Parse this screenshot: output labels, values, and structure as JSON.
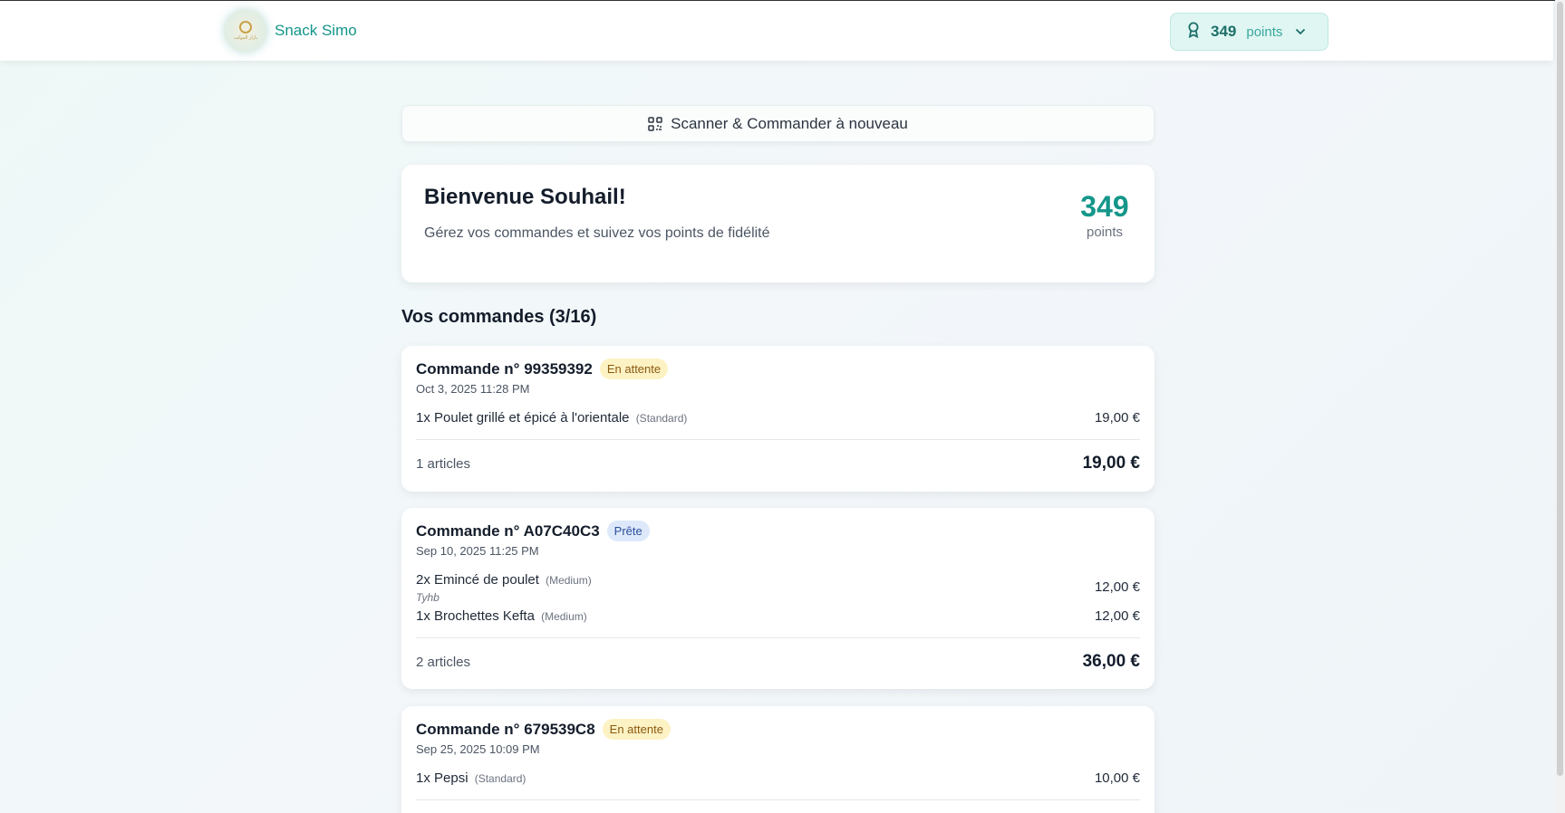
{
  "header": {
    "brand_name": "Snack Simo",
    "logo_text": "بازار الموكب",
    "points_value": "349",
    "points_label": "points"
  },
  "scan_button": {
    "label": "Scanner & Commander à nouveau"
  },
  "welcome": {
    "title": "Bienvenue Souhail!",
    "subtitle": "Gérez vos commandes et suivez vos points de fidélité",
    "points_value": "349",
    "points_label": "points"
  },
  "orders_section": {
    "title": "Vos commandes (3/16)"
  },
  "orders": [
    {
      "title": "Commande n° 99359392",
      "status": "En attente",
      "date": "Oct 3, 2025 11:28 PM",
      "items": [
        {
          "name": "1x Poulet grillé et épicé à l'orientale",
          "size": "(Standard)",
          "price": "19,00 €"
        }
      ],
      "count": "1 articles",
      "total": "19,00 €"
    },
    {
      "title": "Commande n° A07C40C3",
      "status": "Prête",
      "date": "Sep 10, 2025 11:25 PM",
      "items": [
        {
          "name": "2x Emincé de poulet",
          "size": "(Medium)",
          "note": "Tyhb",
          "price": "12,00 €"
        },
        {
          "name": "1x Brochettes Kefta",
          "size": "(Medium)",
          "price": "12,00 €"
        }
      ],
      "count": "2 articles",
      "total": "36,00 €"
    },
    {
      "title": "Commande n° 679539C8",
      "status": "En attente",
      "date": "Sep 25, 2025 10:09 PM",
      "items": [
        {
          "name": "1x Pepsi",
          "size": "(Standard)",
          "price": "10,00 €"
        }
      ]
    }
  ],
  "icons": {
    "award": "award-icon",
    "chevron": "chevron-down-icon",
    "qr": "qr-code-icon"
  },
  "colors": {
    "accent": "#14968a",
    "status_waiting_bg": "#fdf2c4",
    "status_ready_bg": "#dde9fb"
  }
}
